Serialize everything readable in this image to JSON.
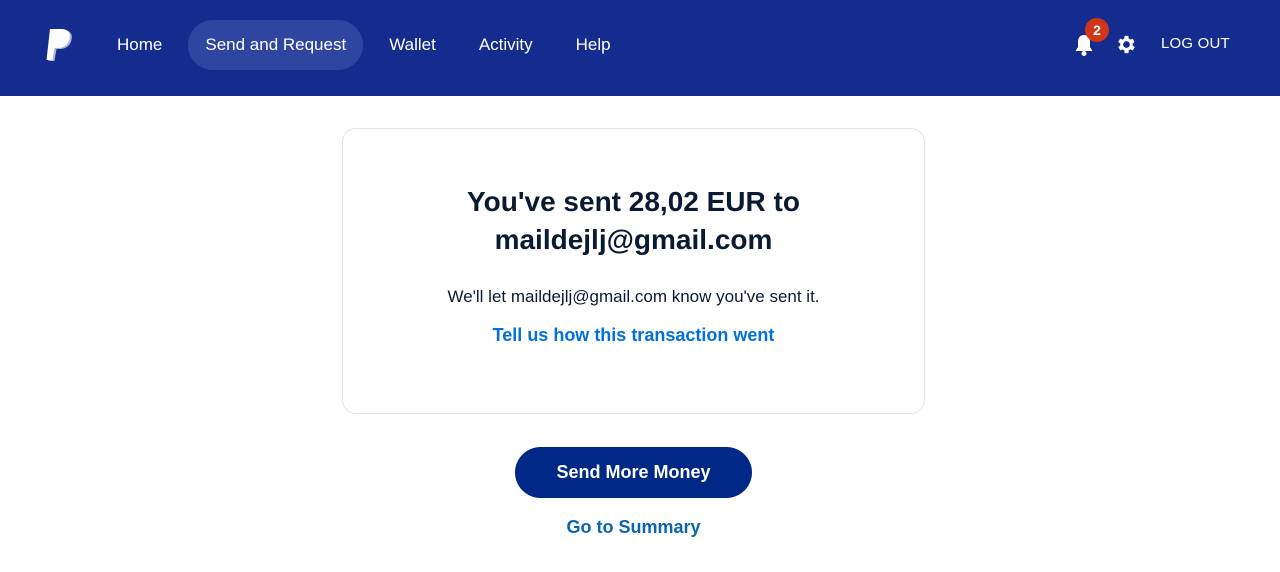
{
  "header": {
    "logo_icon": "paypal-logo-icon",
    "nav": [
      {
        "label": "Home",
        "active": false
      },
      {
        "label": "Send and Request",
        "active": true
      },
      {
        "label": "Wallet",
        "active": false
      },
      {
        "label": "Activity",
        "active": false
      },
      {
        "label": "Help",
        "active": false
      }
    ],
    "notifications": {
      "icon": "bell-icon",
      "count": "2"
    },
    "settings": {
      "icon": "gear-icon"
    },
    "logout_label": "LOG OUT"
  },
  "confirmation": {
    "headline_line1": "You've sent 28,02 EUR to",
    "headline_line2": "maildejlj@gmail.com",
    "subtext": "We'll let maildejlj@gmail.com know you've sent it.",
    "feedback_link": "Tell us how this transaction went"
  },
  "actions": {
    "send_more_label": "Send More Money",
    "summary_link": "Go to Summary"
  },
  "colors": {
    "header_bg": "#142c8e",
    "nav_active_bg": "#2f46a0",
    "badge_bg": "#d0361a",
    "primary_button_bg": "#002987",
    "link_blue": "#0070e0",
    "text_dark": "#0b1a33"
  }
}
